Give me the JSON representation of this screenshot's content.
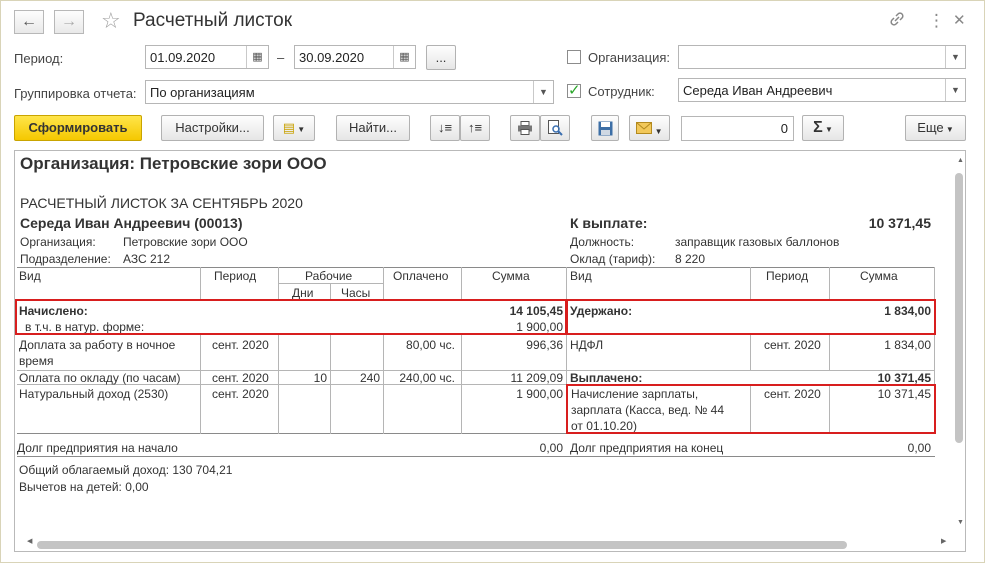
{
  "window": {
    "title": "Расчетный листок"
  },
  "icons": {
    "back": "←",
    "forward": "→",
    "star": "☆",
    "link": "🔗",
    "more": "⋮",
    "close": "✕"
  },
  "form": {
    "period_label": "Период:",
    "date_from": "01.09.2020",
    "dash": "–",
    "date_to": "30.09.2020",
    "more_btn": "...",
    "grouping_label": "Группировка отчета:",
    "grouping_value": "По организациям",
    "org_label": "Организация:",
    "org_value": "",
    "employee_label": "Сотрудник:",
    "employee_value": "Середа Иван Андреевич"
  },
  "toolbar": {
    "generate": "Сформировать",
    "settings": "Настройки...",
    "find": "Найти...",
    "number_value": "0",
    "sigma": "Σ",
    "more": "Еще"
  },
  "report": {
    "org_heading": "Организация: Петровские зори ООО",
    "sheet_title": "РАСЧЕТНЫЙ ЛИСТОК ЗА СЕНТЯБРЬ 2020",
    "employee": "Середа Иван Андреевич (00013)",
    "org_label": "Организация:",
    "org_value": "Петровские зори ООО",
    "dept_label": "Подразделение:",
    "dept_value": "АЗС 212",
    "to_pay_label": "К выплате:",
    "to_pay_value": "10 371,45",
    "position_label": "Должность:",
    "position_value": "заправщик газовых баллонов",
    "salary_label": "Оклад (тариф):",
    "salary_value": "8 220",
    "headers": {
      "kind": "Вид",
      "period": "Период",
      "working": "Рабочие",
      "days": "Дни",
      "hours": "Часы",
      "paid": "Оплачено",
      "sum": "Сумма",
      "kind2": "Вид",
      "period2": "Период",
      "sum2": "Сумма"
    },
    "accrued_label": "Начислено:",
    "accrued_value": "14 105,45",
    "natural_label": "в т.ч. в натур. форме:",
    "natural_value": "1 900,00",
    "withheld_label": "Удержано:",
    "withheld_value": "1 834,00",
    "rows_left": [
      {
        "kind": "Доплата за работу в ночное",
        "kind2": "время",
        "period": "сент. 2020",
        "days": "",
        "hours": "",
        "paid": "80,00 чс.",
        "sum": "996,36"
      },
      {
        "kind": "Оплата по окладу (по часам)",
        "period": "сент. 2020",
        "days": "10",
        "hours": "240",
        "paid": "240,00 чс.",
        "sum": "11 209,09"
      },
      {
        "kind": "Натуральный доход (2530)",
        "period": "сент. 2020",
        "days": "",
        "hours": "",
        "paid": "",
        "sum": "1 900,00"
      }
    ],
    "ndfl": {
      "kind": "НДФЛ",
      "period": "сент. 2020",
      "sum": "1 834,00"
    },
    "paid_out_label": "Выплачено:",
    "paid_out_value": "10 371,45",
    "payout_row": {
      "line1": "Начисление зарплаты,",
      "line2": "зарплата (Касса, вед. № 44",
      "line3": "от 01.10.20)",
      "period": "сент. 2020",
      "sum": "10 371,45"
    },
    "debt_start_label": "Долг предприятия на начало",
    "debt_start_value": "0,00",
    "debt_end_label": "Долг предприятия на конец",
    "debt_end_value": "0,00",
    "taxable_income": "Общий облагаемый доход: 130 704,21",
    "child_deductions": "Вычетов на детей: 0,00"
  }
}
